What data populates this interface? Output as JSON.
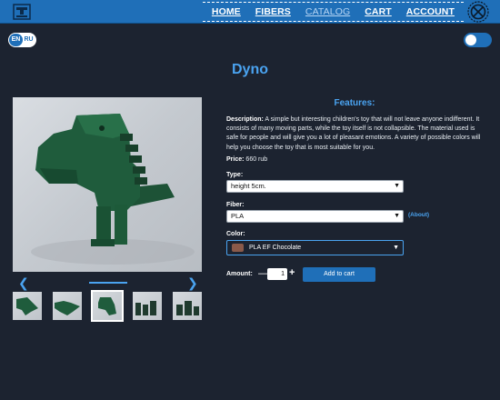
{
  "nav": {
    "home": "HOME",
    "fibers": "FIBERS",
    "catalog": "CATALOG",
    "cart": "CART",
    "account": "ACCOUNT"
  },
  "lang": {
    "en": "EN",
    "ru": "RU"
  },
  "product": {
    "title": "Dyno",
    "features_title": "Features:",
    "description_label": "Description:",
    "description_text": "A simple but interesting children's toy that will not leave anyone indifferent. It consists of many moving parts, while the toy itself is not collapsible. The material used is safe for people and will give you a lot of pleasant emotions. A variety of possible colors will help you choose the toy that is most suitable for you.",
    "price_label": "Price:",
    "price_value": "660 rub",
    "type_label": "Type:",
    "type_value": "height 5cm.",
    "fiber_label": "Fiber:",
    "fiber_value": "PLA",
    "about_link": "(About)",
    "color_label": "Color:",
    "color_value": "PLA EF Chocolate",
    "amount_label": "Amount:",
    "amount_value": "1",
    "minus": "—",
    "plus": "+",
    "add_to_cart": "Add to cart"
  },
  "gallery": {
    "selected_index": 2,
    "thumb_count": 5
  },
  "colors": {
    "header_bg": "#1f6fb8",
    "page_bg": "#1c2330",
    "accent": "#4aa3f0",
    "dino_green": "#1f5c3c",
    "swatch": "#8a5a4a"
  }
}
